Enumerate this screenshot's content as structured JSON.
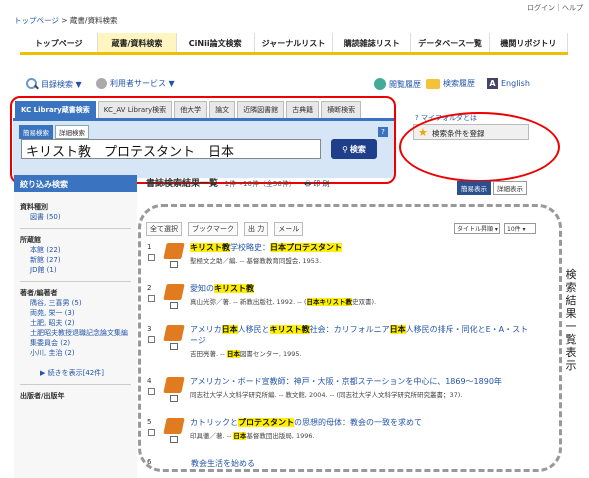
{
  "topright": "ログイン｜ヘルプ",
  "breadcrumb": {
    "home": "トップページ",
    "sep": " > ",
    "current": "蔵書/資料検索"
  },
  "nav": [
    "トップページ",
    "蔵書/資料検索",
    "CiNii論文検索",
    "ジャーナルリスト",
    "購読雑誌リスト",
    "データベース一覧",
    "機関リポジトリ"
  ],
  "svc": {
    "search_list": "目録検索 ▼",
    "user_service": "利用者サービス ▼",
    "history": "閲覧履歴",
    "search_history": "検索履歴",
    "english": "English"
  },
  "searchtabs": [
    "KC Library蔵書検索",
    "KC_AV Library検索",
    "他大学",
    "論文",
    "近隣図書館",
    "古典籍",
    "横断検索"
  ],
  "subtabs": [
    "簡易検索",
    "詳細検索"
  ],
  "query": "キリスト教　プロテスタント　日本",
  "search_button": "検索",
  "myfolder": "マイフォルダとは",
  "save_condition": "検索条件を登録",
  "sidebar": {
    "head": "絞り込み検索",
    "g1_title": "資料種別",
    "g1": [
      "図書 (50)"
    ],
    "g2_title": "所蔵館",
    "g2": [
      "本館 (22)",
      "新館 (27)",
      "JD館 (1)"
    ],
    "g3_title": "著者/編著者",
    "g3": [
      "隅谷, 三喜男 (5)",
      "両苑, 栄一 (3)",
      "土肥, 昭夫 (2)",
      "土肥昭夫教授退職記念論文集編",
      "集委員会 (2)",
      "小川, 圭治 (2)"
    ],
    "more": "続きを表示[42件]",
    "g4_title": "出版者/出版年"
  },
  "results_head": {
    "title": "書誌検索結果一覧",
    "count": "1件〜10件（全50件）",
    "print": "印 刷"
  },
  "viewtabs": [
    "簡易表示",
    "詳細表示"
  ],
  "toolbar": [
    "全て選択",
    "ブックマーク",
    "出 力",
    "メール"
  ],
  "sort_label": "タイトル昇順",
  "count_label": "10件",
  "vertical_label": "検索結果一覧表示",
  "records": [
    {
      "num": "1",
      "title_html": "<mark>キリスト教</mark>学校略史：<mark>日本プロテスタント</mark>",
      "meta_html": "聖極文之助／編. -- 基督教教育同盟会, 1953."
    },
    {
      "num": "2",
      "title_html": "愛知の<mark>キリスト教</mark>",
      "meta_html": "真山光弥／著. -- 新教出版社, 1992. -- (<mark>日本キリスト教</mark>史双書)."
    },
    {
      "num": "3",
      "title_html": "アメリカ<mark>日本</mark>人移民と<mark>キリスト教</mark>社会：カリフォルニア<mark>日本</mark>人移民の排斥・同化とE・A・ストージ",
      "meta_html": "吉田亮著. -- <mark>日本</mark>図書センター, 1995.",
      "tall": true
    },
    {
      "num": "4",
      "title_html": "アメリカン・ボード宣教師：神戸・大阪・京都ステーションを中心に、1869〜1890年",
      "meta_html": "同志社大学人文科学研究所編. -- 教文館, 2004. -- (同志社大学人文科学研究所研究叢書；37)."
    },
    {
      "num": "5",
      "title_html": "カトリックと<mark>プロテスタント</mark>の思想的母体：教会の一致を求めて",
      "meta_html": "印具徹／著. -- <mark>日本</mark>基督教団出版局, 1996."
    }
  ],
  "record6_num": "6",
  "record6_title": "教会生活を始める"
}
